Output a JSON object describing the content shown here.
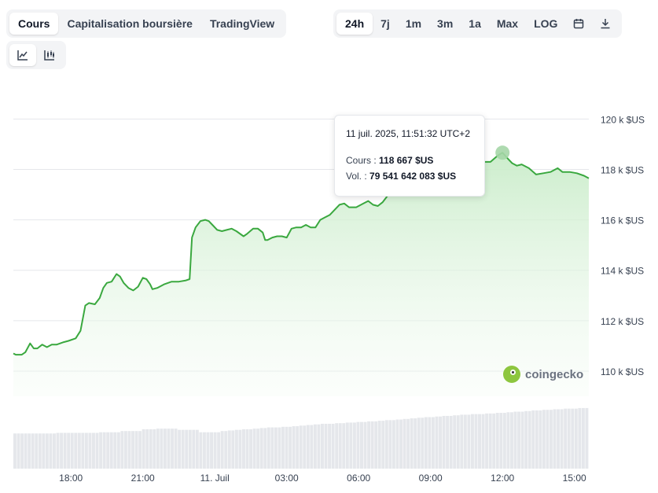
{
  "tabs": [
    "Cours",
    "Capitalisation boursière",
    "TradingView"
  ],
  "active_tab": 0,
  "ranges": [
    "24h",
    "7j",
    "1m",
    "3m",
    "1a",
    "Max",
    "LOG"
  ],
  "active_range": 0,
  "icons": {
    "calendar": "calendar-icon",
    "download": "download-icon",
    "line": "line-chart-icon",
    "candle": "candlestick-icon"
  },
  "tooltip": {
    "date": "11 juil. 2025, 11:51:32 UTC+2",
    "price_label": "Cours :",
    "price_value": "118 667 $US",
    "vol_label": "Vol. :",
    "vol_value": "79 541 642 083 $US"
  },
  "watermark": "coingecko",
  "colors": {
    "line": "#3aa83f",
    "area_top": "#c9ecc9",
    "volume": "#e5e7eb",
    "grid": "#e5e7eb"
  },
  "chart_data": {
    "type": "area",
    "ylim": [
      109000,
      120200
    ],
    "y_ticks": [
      110000,
      112000,
      114000,
      116000,
      118000,
      120000
    ],
    "y_tick_labels": [
      "110 k $US",
      "112 k $US",
      "114 k $US",
      "116 k $US",
      "118 k $US",
      "120 k $US"
    ],
    "x_ticks": [
      {
        "label": "18:00",
        "t": 2.4
      },
      {
        "label": "21:00",
        "t": 5.4
      },
      {
        "label": "11. Juil",
        "t": 8.4
      },
      {
        "label": "03:00",
        "t": 11.4
      },
      {
        "label": "06:00",
        "t": 14.4
      },
      {
        "label": "09:00",
        "t": 17.4
      },
      {
        "label": "12:00",
        "t": 20.4
      },
      {
        "label": "15:00",
        "t": 23.4
      }
    ],
    "t_range": [
      0,
      24
    ],
    "series": [
      {
        "points": [
          [
            0.0,
            110700
          ],
          [
            0.1,
            110650
          ],
          [
            0.35,
            110650
          ],
          [
            0.5,
            110750
          ],
          [
            0.7,
            111100
          ],
          [
            0.85,
            110900
          ],
          [
            1.0,
            110900
          ],
          [
            1.2,
            111050
          ],
          [
            1.4,
            110950
          ],
          [
            1.6,
            111050
          ],
          [
            1.8,
            111050
          ],
          [
            2.1,
            111150
          ],
          [
            2.3,
            111200
          ],
          [
            2.6,
            111300
          ],
          [
            2.8,
            111600
          ],
          [
            3.0,
            112600
          ],
          [
            3.15,
            112700
          ],
          [
            3.4,
            112650
          ],
          [
            3.6,
            112900
          ],
          [
            3.75,
            113300
          ],
          [
            3.9,
            113500
          ],
          [
            4.1,
            113550
          ],
          [
            4.3,
            113850
          ],
          [
            4.45,
            113750
          ],
          [
            4.6,
            113500
          ],
          [
            4.8,
            113300
          ],
          [
            5.0,
            113200
          ],
          [
            5.2,
            113350
          ],
          [
            5.4,
            113700
          ],
          [
            5.55,
            113650
          ],
          [
            5.7,
            113450
          ],
          [
            5.8,
            113250
          ],
          [
            6.0,
            113300
          ],
          [
            6.3,
            113450
          ],
          [
            6.6,
            113550
          ],
          [
            6.9,
            113550
          ],
          [
            7.2,
            113600
          ],
          [
            7.35,
            113650
          ],
          [
            7.45,
            115300
          ],
          [
            7.6,
            115700
          ],
          [
            7.8,
            115950
          ],
          [
            8.0,
            116000
          ],
          [
            8.15,
            115950
          ],
          [
            8.3,
            115800
          ],
          [
            8.5,
            115600
          ],
          [
            8.7,
            115550
          ],
          [
            8.9,
            115600
          ],
          [
            9.1,
            115650
          ],
          [
            9.3,
            115550
          ],
          [
            9.6,
            115350
          ],
          [
            9.75,
            115450
          ],
          [
            10.0,
            115650
          ],
          [
            10.2,
            115650
          ],
          [
            10.4,
            115500
          ],
          [
            10.5,
            115200
          ],
          [
            10.6,
            115200
          ],
          [
            10.8,
            115300
          ],
          [
            11.0,
            115350
          ],
          [
            11.2,
            115350
          ],
          [
            11.4,
            115300
          ],
          [
            11.6,
            115650
          ],
          [
            11.8,
            115700
          ],
          [
            12.0,
            115700
          ],
          [
            12.2,
            115800
          ],
          [
            12.4,
            115700
          ],
          [
            12.6,
            115700
          ],
          [
            12.8,
            116000
          ],
          [
            13.0,
            116100
          ],
          [
            13.2,
            116200
          ],
          [
            13.4,
            116400
          ],
          [
            13.6,
            116600
          ],
          [
            13.8,
            116650
          ],
          [
            14.0,
            116500
          ],
          [
            14.3,
            116500
          ],
          [
            14.6,
            116650
          ],
          [
            14.8,
            116750
          ],
          [
            15.0,
            116600
          ],
          [
            15.2,
            116550
          ],
          [
            15.4,
            116700
          ],
          [
            15.6,
            116950
          ],
          [
            15.8,
            117300
          ],
          [
            16.0,
            117500
          ],
          [
            16.3,
            117800
          ],
          [
            16.6,
            117900
          ],
          [
            16.9,
            117900
          ],
          [
            17.2,
            118050
          ],
          [
            17.5,
            118050
          ],
          [
            17.8,
            118050
          ],
          [
            18.1,
            118100
          ],
          [
            18.4,
            118100
          ],
          [
            18.7,
            118100
          ],
          [
            19.0,
            118150
          ],
          [
            19.3,
            118200
          ],
          [
            19.6,
            118300
          ],
          [
            19.9,
            118300
          ],
          [
            20.2,
            118550
          ],
          [
            20.4,
            118667
          ],
          [
            20.6,
            118450
          ],
          [
            20.8,
            118250
          ],
          [
            21.0,
            118150
          ],
          [
            21.2,
            118200
          ],
          [
            21.5,
            118050
          ],
          [
            21.8,
            117800
          ],
          [
            22.1,
            117850
          ],
          [
            22.4,
            117900
          ],
          [
            22.7,
            118050
          ],
          [
            22.9,
            117900
          ],
          [
            23.2,
            117900
          ],
          [
            23.5,
            117850
          ],
          [
            23.8,
            117750
          ],
          [
            24.0,
            117650
          ]
        ]
      }
    ],
    "volume": {
      "ylim": [
        0,
        110000000000
      ],
      "values": [
        58,
        58,
        58,
        58,
        58,
        58,
        58,
        58,
        58,
        58,
        58,
        58,
        59,
        59,
        59,
        59,
        59,
        59,
        59,
        59,
        59,
        59,
        59,
        59,
        60,
        60,
        60,
        60,
        60,
        60,
        62,
        62,
        62,
        62,
        62,
        62,
        65,
        65,
        65,
        65,
        66,
        66,
        66,
        66,
        66,
        66,
        64,
        64,
        64,
        64,
        64,
        64,
        60,
        60,
        60,
        60,
        60,
        60,
        62,
        62,
        63,
        63,
        64,
        64,
        65,
        65,
        65,
        66,
        66,
        67,
        67,
        68,
        68,
        68,
        68,
        69,
        69,
        69,
        70,
        70,
        71,
        71,
        72,
        72,
        73,
        73,
        74,
        74,
        74,
        74,
        75,
        75,
        75,
        76,
        76,
        76,
        77,
        77,
        77,
        78,
        78,
        78,
        79,
        79,
        80,
        80,
        80,
        81,
        81,
        82,
        82,
        83,
        83,
        84,
        84,
        85,
        85,
        85,
        86,
        86,
        87,
        87,
        87,
        88,
        88,
        89,
        89,
        89,
        90,
        90,
        90,
        90,
        91,
        91,
        91,
        92,
        92,
        92,
        93,
        93,
        94,
        94,
        94,
        95,
        95,
        96,
        96,
        96,
        97,
        97,
        97,
        98,
        98,
        98,
        99,
        99,
        99,
        99,
        100,
        100,
        100
      ]
    }
  }
}
